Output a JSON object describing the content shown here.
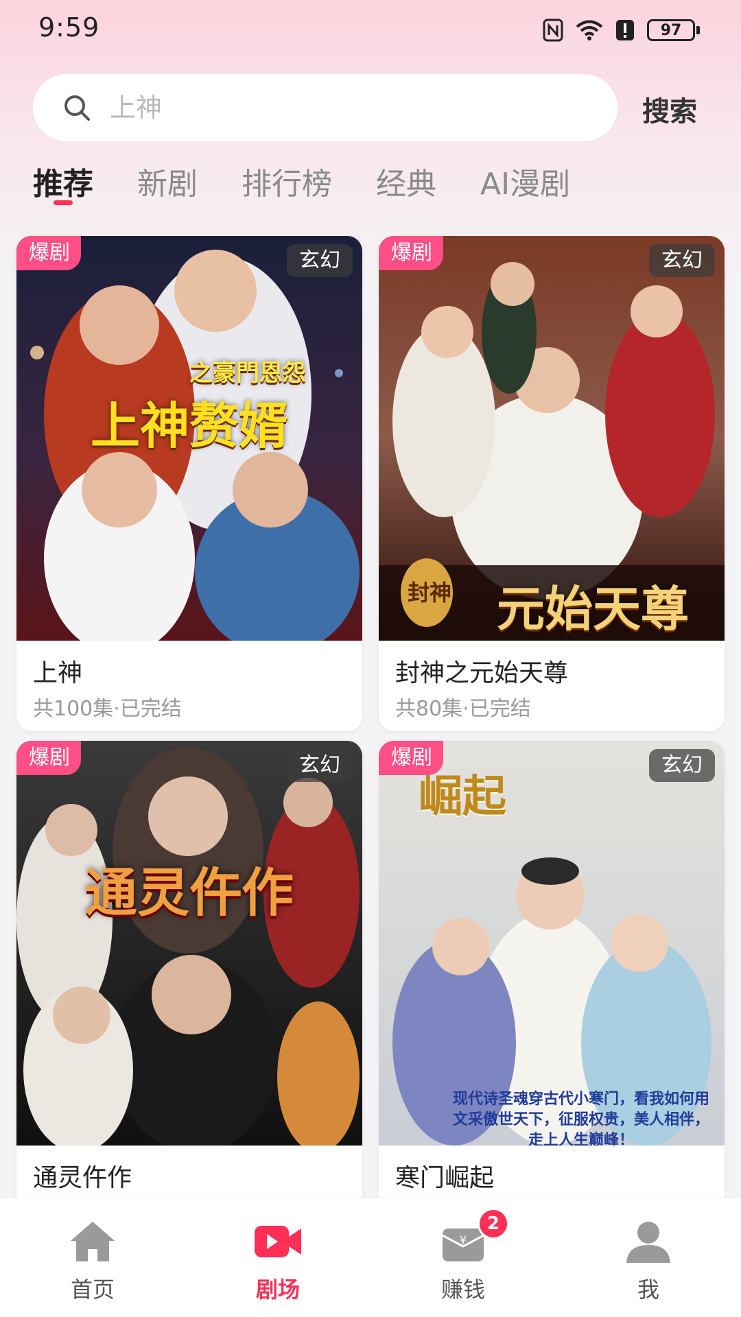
{
  "status_bar": {
    "time": "9:59",
    "battery": "97"
  },
  "search": {
    "placeholder": "上神",
    "button_label": "搜索"
  },
  "tabs": [
    {
      "label": "推荐",
      "active": true
    },
    {
      "label": "新剧",
      "active": false
    },
    {
      "label": "排行榜",
      "active": false
    },
    {
      "label": "经典",
      "active": false
    },
    {
      "label": "AI漫剧",
      "active": false
    }
  ],
  "dramas": [
    {
      "title": "上神",
      "meta": "共100集·已完结",
      "badge": "爆剧",
      "genre": "玄幻",
      "poster_title": "上神赘婿",
      "poster_subtitle": "之豪門恩怨"
    },
    {
      "title": "封神之元始天尊",
      "meta": "共80集·已完结",
      "badge": "爆剧",
      "genre": "玄幻",
      "poster_title": "元始天尊",
      "poster_subtitle": "封神"
    },
    {
      "title": "通灵仵作",
      "meta": "",
      "badge": "爆剧",
      "genre": "玄幻",
      "poster_title": "通灵仵作",
      "poster_subtitle": ""
    },
    {
      "title": "寒门崛起",
      "meta": "",
      "badge": "爆剧",
      "genre": "玄幻",
      "poster_title": "崛起",
      "poster_subtitle": "现代诗圣魂穿古代小寒门，看我如何用文采傲世天下，征服权贵，美人相伴，走上人生巅峰！"
    }
  ],
  "bottom_nav": [
    {
      "label": "首页",
      "icon": "home-icon",
      "active": false
    },
    {
      "label": "剧场",
      "icon": "video-icon",
      "active": true
    },
    {
      "label": "赚钱",
      "icon": "wallet-icon",
      "active": false,
      "badge": "2"
    },
    {
      "label": "我",
      "icon": "user-icon",
      "active": false
    }
  ],
  "colors": {
    "accent": "#ff2f55",
    "hot_badge": "#ff4f86",
    "genre_badge": "#3c3c3c"
  }
}
